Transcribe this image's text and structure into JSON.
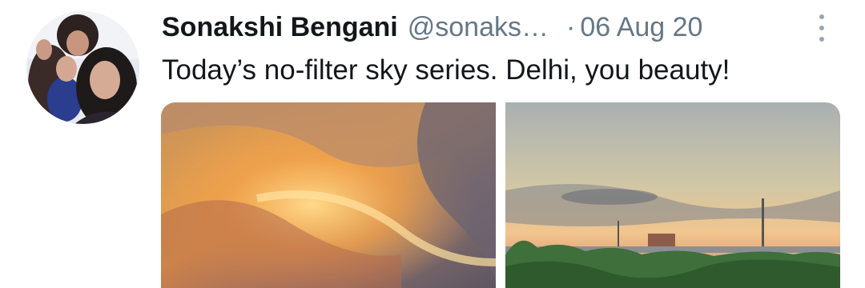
{
  "tweet": {
    "author_name": "Sonakshi Bengani",
    "handle": "@sonaks…",
    "separator": "·",
    "date": "06 Aug 20",
    "text": "Today’s no-filter sky series. Delhi, you beauty!"
  },
  "icons": {
    "more": "more-vertical-icon"
  },
  "colors": {
    "text_primary": "#14171a",
    "text_secondary": "#657786",
    "more_icon": "#9aa5b0"
  }
}
